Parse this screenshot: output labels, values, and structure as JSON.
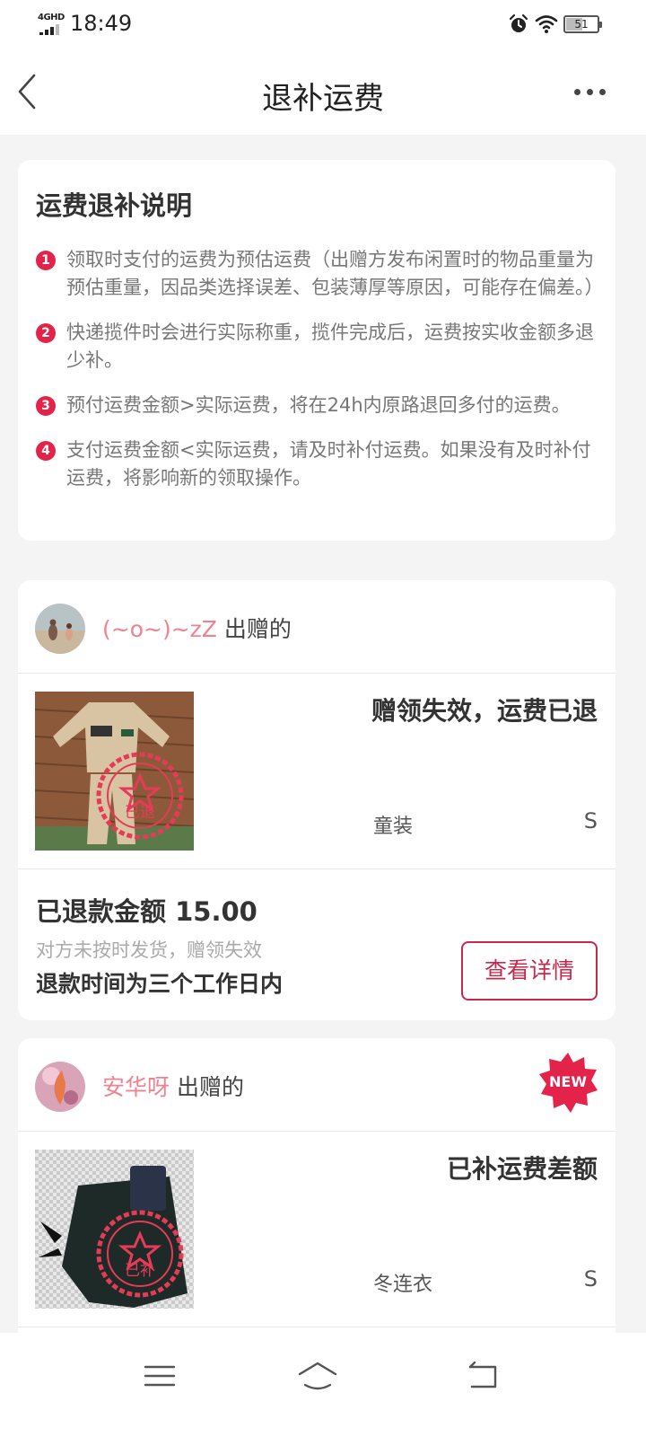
{
  "status_bar": {
    "network": "4GHD",
    "time": "18:49",
    "battery": "51"
  },
  "nav": {
    "title": "退补运费"
  },
  "info": {
    "title": "运费退补说明",
    "rules": [
      {
        "num": "1",
        "text": "领取时支付的运费为预估运费（出赠方发布闲置时的物品重量为预估重量，因品类选择误差、包装薄厚等原因，可能存在偏差。）"
      },
      {
        "num": "2",
        "text": "快递揽件时会进行实际称重，揽件完成后，运费按实收金额多退少补。"
      },
      {
        "num": "3",
        "text": "预付运费金额>实际运费，将在24h内原路退回多付的运费。"
      },
      {
        "num": "4",
        "text": "支付运费金额<实际运费，请及时补付运费。如果没有及时补付运费，将影响新的领取操作。"
      }
    ]
  },
  "orders": [
    {
      "donor": "(~o~)~zZ",
      "donor_suffix": "出赠的",
      "status": "赠领失效，运费已退",
      "stamp": "已退",
      "category": "童装",
      "size": "S",
      "refund_amount": "已退款金额 15.00",
      "reason": "对方未按时发货，赠领失效",
      "refund_time": "退款时间为三个工作日内",
      "button": "查看详情"
    },
    {
      "donor": "安华呀",
      "donor_suffix": "出赠的",
      "badge": "NEW",
      "status": "已补运费差额",
      "stamp": "已补",
      "category": "冬连衣",
      "size": "S"
    }
  ]
}
